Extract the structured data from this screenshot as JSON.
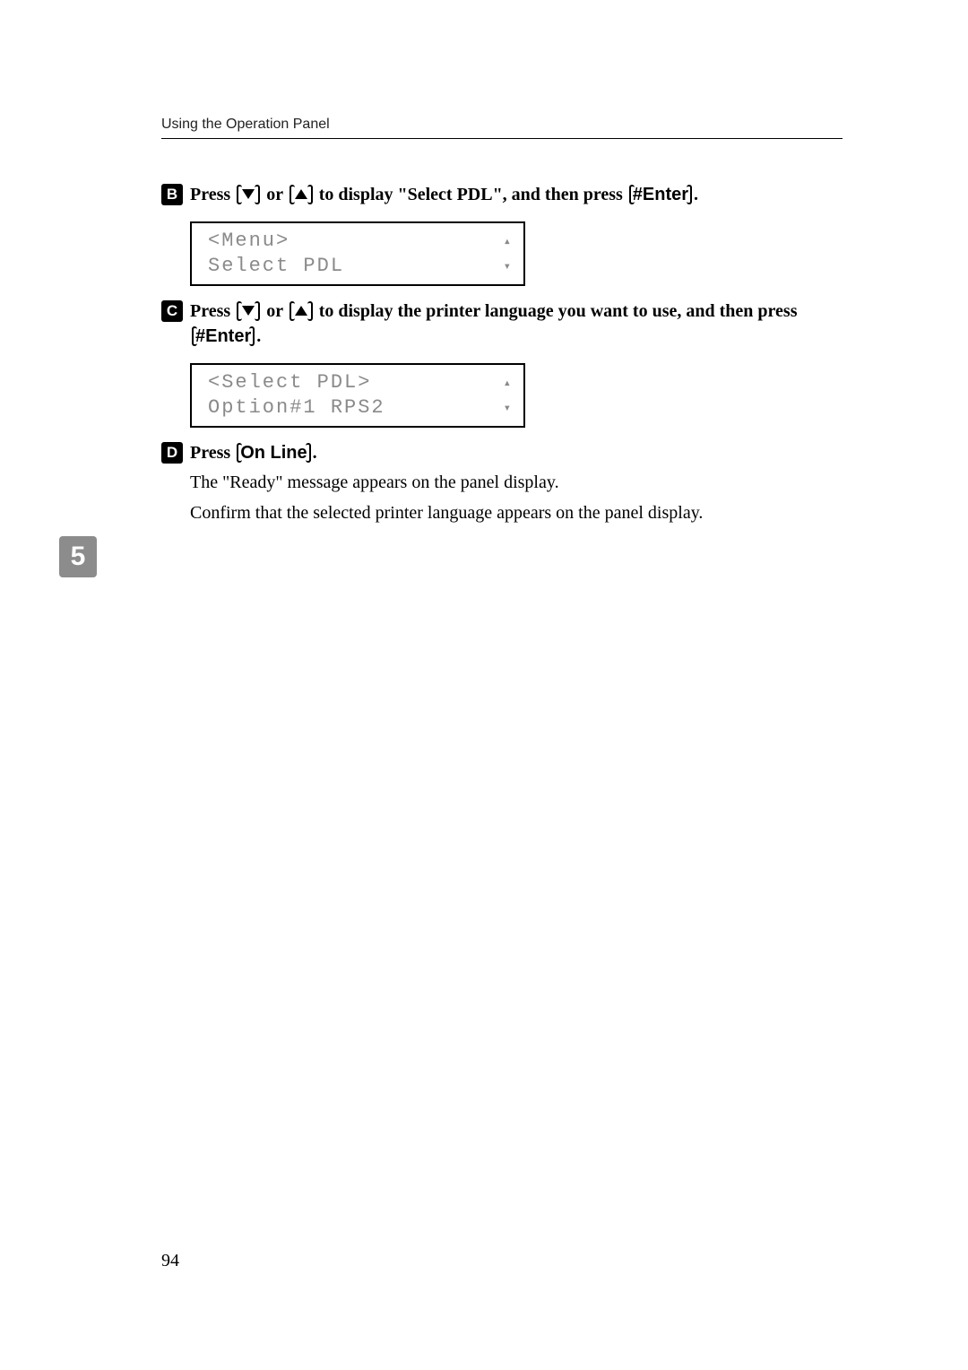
{
  "header": "Using the Operation Panel",
  "side_tab": "5",
  "page_number": "94",
  "steps": {
    "s2": {
      "num": "B",
      "press": "Press",
      "or": " or ",
      "tail": " to display \"Select PDL\", and then press ",
      "enter": "#Enter",
      "period": ".",
      "lcd": {
        "l1": "<Menu>",
        "l2": " Select PDL"
      }
    },
    "s3": {
      "num": "C",
      "press": "Press",
      "or": " or ",
      "tail": " to display the printer language you want to use, and then press ",
      "enter": "#Enter",
      "period": ".",
      "lcd": {
        "l1": "<Select PDL>",
        "l2": " Option#1 RPS2"
      }
    },
    "s4": {
      "num": "D",
      "press": "Press ",
      "online": "On Line",
      "period": ".",
      "body1": "The \"Ready\" message appears on the panel display.",
      "body2": "Confirm that the selected printer language appears on the panel display."
    }
  }
}
